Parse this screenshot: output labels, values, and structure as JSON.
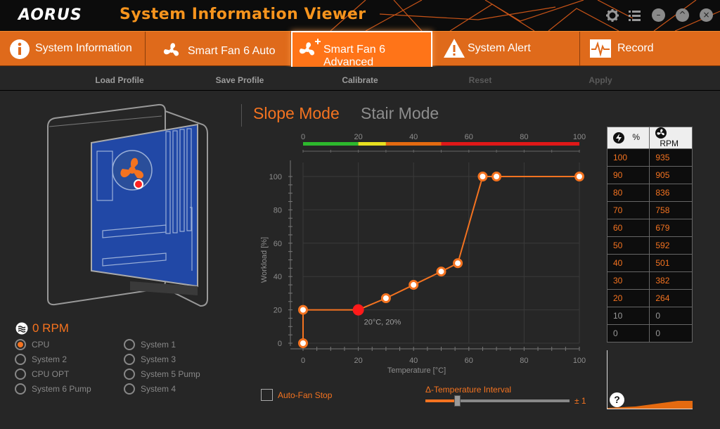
{
  "app": {
    "logo": "AORUS",
    "title": "System Information Viewer"
  },
  "window_buttons": {
    "minimize": "–",
    "maximize": "^",
    "close": "×"
  },
  "tabs": [
    {
      "label": "System Information",
      "icon": "info-icon"
    },
    {
      "label": "Smart Fan 6 Auto",
      "icon": "fan-icon"
    },
    {
      "label": "Smart Fan 6 Advanced",
      "icon": "fan-plus-icon",
      "active": true
    },
    {
      "label": "System Alert",
      "icon": "warning-icon"
    },
    {
      "label": "Record",
      "icon": "heartbeat-icon"
    }
  ],
  "toolbar": {
    "load": "Load Profile",
    "save": "Save Profile",
    "calibrate": "Calibrate",
    "reset": "Reset",
    "apply": "Apply"
  },
  "fan": {
    "speed": "0 RPM"
  },
  "fan_sources": [
    {
      "label": "CPU",
      "selected": true
    },
    {
      "label": "System 2",
      "selected": false
    },
    {
      "label": "CPU OPT",
      "selected": false
    },
    {
      "label": "System 6 Pump",
      "selected": false
    },
    {
      "label": "System 1",
      "selected": false
    },
    {
      "label": "System 3",
      "selected": false
    },
    {
      "label": "System 5 Pump",
      "selected": false
    },
    {
      "label": "System 4",
      "selected": false
    }
  ],
  "modes": {
    "slope": "Slope Mode",
    "stair": "Stair Mode",
    "active": "slope"
  },
  "chart_data": {
    "type": "line",
    "xlabel": "Temperature [°C]",
    "ylabel": "Workload [%]",
    "xlim": [
      0,
      100
    ],
    "ylim": [
      0,
      100
    ],
    "xticks": [
      "0",
      "20",
      "40",
      "60",
      "80",
      "100"
    ],
    "yticks": [
      "0",
      "20",
      "40",
      "60",
      "80",
      "100"
    ],
    "color_bar_ticks": [
      "0",
      "20",
      "40",
      "60",
      "80",
      "100"
    ],
    "color_bar": [
      {
        "from": 0,
        "to": 20,
        "color": "#2db82d"
      },
      {
        "from": 20,
        "to": 30,
        "color": "#e8e020"
      },
      {
        "from": 30,
        "to": 50,
        "color": "#e46a10"
      },
      {
        "from": 50,
        "to": 100,
        "color": "#e01818"
      }
    ],
    "grid": true,
    "series": [
      {
        "x": [
          0,
          0,
          20,
          30,
          40,
          50,
          56,
          65,
          70,
          100
        ],
        "y": [
          0,
          20,
          20,
          27,
          35,
          43,
          48,
          100,
          100,
          100
        ],
        "color": "#f47320"
      }
    ],
    "highlight": {
      "x": 20,
      "y": 20,
      "label": "20°C, 20%"
    }
  },
  "options": {
    "auto_fan_stop": "Auto-Fan Stop",
    "temp_interval": "Δ-Temperature Interval",
    "interval_value": "± 1",
    "slider_level": 0.22
  },
  "rpm_table": {
    "header": {
      "pct": "%",
      "rpm": "RPM"
    },
    "rows": [
      {
        "pct": "100",
        "rpm": "935",
        "on": true
      },
      {
        "pct": "90",
        "rpm": "905",
        "on": true
      },
      {
        "pct": "80",
        "rpm": "836",
        "on": true
      },
      {
        "pct": "70",
        "rpm": "758",
        "on": true
      },
      {
        "pct": "60",
        "rpm": "679",
        "on": true
      },
      {
        "pct": "50",
        "rpm": "592",
        "on": true
      },
      {
        "pct": "40",
        "rpm": "501",
        "on": true
      },
      {
        "pct": "30",
        "rpm": "382",
        "on": true
      },
      {
        "pct": "20",
        "rpm": "264",
        "on": true
      },
      {
        "pct": "10",
        "rpm": "0",
        "on": false
      },
      {
        "pct": "0",
        "rpm": "0",
        "on": false
      }
    ]
  },
  "help": "?"
}
